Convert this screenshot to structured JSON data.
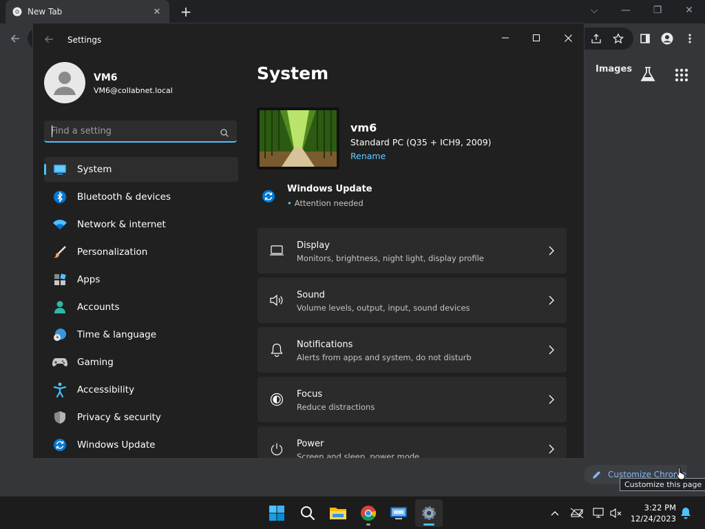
{
  "chrome": {
    "tab_title": "New Tab",
    "new_tab": "+",
    "links": {
      "images": "Images"
    },
    "customize": {
      "label": "Customize Chrome",
      "tooltip": "Customize this page"
    }
  },
  "settings": {
    "app_title": "Settings",
    "profile": {
      "name": "VM6",
      "email": "VM6@collabnet.local"
    },
    "search": {
      "placeholder": "Find a setting"
    },
    "nav": [
      {
        "label": "System",
        "icon": "system-icon",
        "selected": true
      },
      {
        "label": "Bluetooth & devices",
        "icon": "bluetooth-icon"
      },
      {
        "label": "Network & internet",
        "icon": "wifi-icon"
      },
      {
        "label": "Personalization",
        "icon": "brush-icon"
      },
      {
        "label": "Apps",
        "icon": "apps-icon"
      },
      {
        "label": "Accounts",
        "icon": "person-icon"
      },
      {
        "label": "Time & language",
        "icon": "globe-clock-icon"
      },
      {
        "label": "Gaming",
        "icon": "gamepad-icon"
      },
      {
        "label": "Accessibility",
        "icon": "accessibility-icon"
      },
      {
        "label": "Privacy & security",
        "icon": "shield-icon"
      },
      {
        "label": "Windows Update",
        "icon": "update-icon"
      }
    ],
    "page_title": "System",
    "device": {
      "name": "vm6",
      "model": "Standard PC (Q35 + ICH9, 2009)",
      "rename": "Rename"
    },
    "windows_update": {
      "title": "Windows Update",
      "status": "Attention needed"
    },
    "cards": [
      {
        "title": "Display",
        "subtitle": "Monitors, brightness, night light, display profile",
        "icon": "monitor-icon"
      },
      {
        "title": "Sound",
        "subtitle": "Volume levels, output, input, sound devices",
        "icon": "speaker-icon"
      },
      {
        "title": "Notifications",
        "subtitle": "Alerts from apps and system, do not disturb",
        "icon": "bell-icon"
      },
      {
        "title": "Focus",
        "subtitle": "Reduce distractions",
        "icon": "focus-icon"
      },
      {
        "title": "Power",
        "subtitle": "Screen and sleep, power mode",
        "icon": "power-icon"
      }
    ]
  },
  "taskbar": {
    "apps": [
      "start-icon",
      "search-icon",
      "file-explorer-icon",
      "chrome-icon",
      "remote-desktop-icon",
      "settings-gear-icon"
    ],
    "time": "3:22 PM",
    "date": "12/24/2023"
  },
  "colors": {
    "accent": "#4cc2ff",
    "link": "#60cdff",
    "window_bg": "#202020",
    "card_bg": "#2b2b2b",
    "chrome_toolbar": "#35363a"
  }
}
